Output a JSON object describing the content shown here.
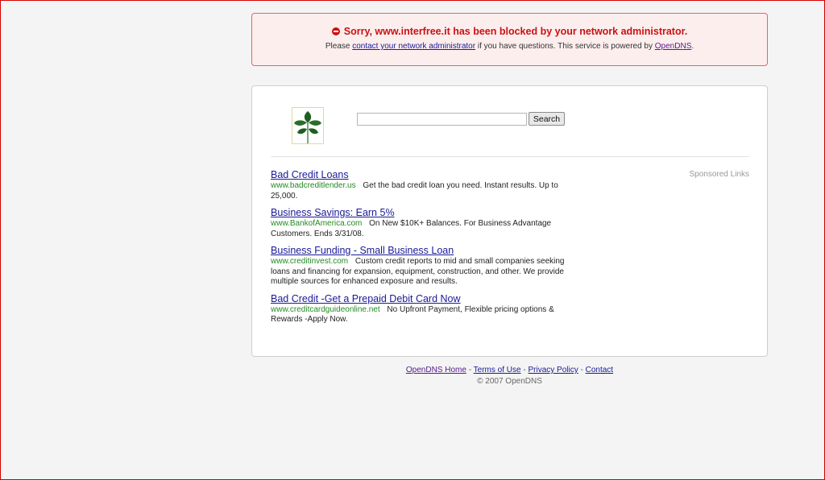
{
  "blocked": {
    "title": "Sorry, www.interfree.it has been blocked by your network administrator.",
    "sub_prefix": "Please",
    "contact_link": "contact your network administrator",
    "sub_middle": "if you have questions. This service is powered by",
    "opendns_link": "OpenDNS",
    "sub_suffix": "."
  },
  "search": {
    "value": "",
    "button_label": "Search"
  },
  "sponsored_label": "Sponsored Links",
  "ads": [
    {
      "title": "Bad Credit Loans",
      "url": "www.badcreditlender.us",
      "desc": "Get the bad credit loan you need. Instant results. Up to 25,000."
    },
    {
      "title": "Business Savings: Earn 5%",
      "url": "www.BankofAmerica.com",
      "desc": "On New $10K+ Balances. For Business Advantage Customers. Ends 3/31/08."
    },
    {
      "title": "Business Funding - Small Business Loan",
      "url": "www.creditinvest.com",
      "desc": "Custom credit reports to mid and small companies seeking loans and financing for expansion, equipment, construction, and other. We provide multiple sources for enhanced exposure and results."
    },
    {
      "title": "Bad Credit -Get a Prepaid Debit Card Now",
      "url": "www.creditcardguideonline.net",
      "desc": "No Upfront Payment, Flexible pricing options & Rewards -Apply Now."
    }
  ],
  "footer": {
    "home": "OpenDNS Home",
    "terms": "Terms of Use",
    "privacy": "Privacy Policy",
    "contact": "Contact",
    "separator": "-",
    "copyright": "© 2007 OpenDNS"
  },
  "colors": {
    "error_red": "#cc1111",
    "link_blue": "#1a1a99",
    "ad_url_green": "#238a23",
    "frame_red": "#d40000"
  },
  "icons": {
    "blocked": "stop-icon",
    "logo": "leaf-logo"
  }
}
